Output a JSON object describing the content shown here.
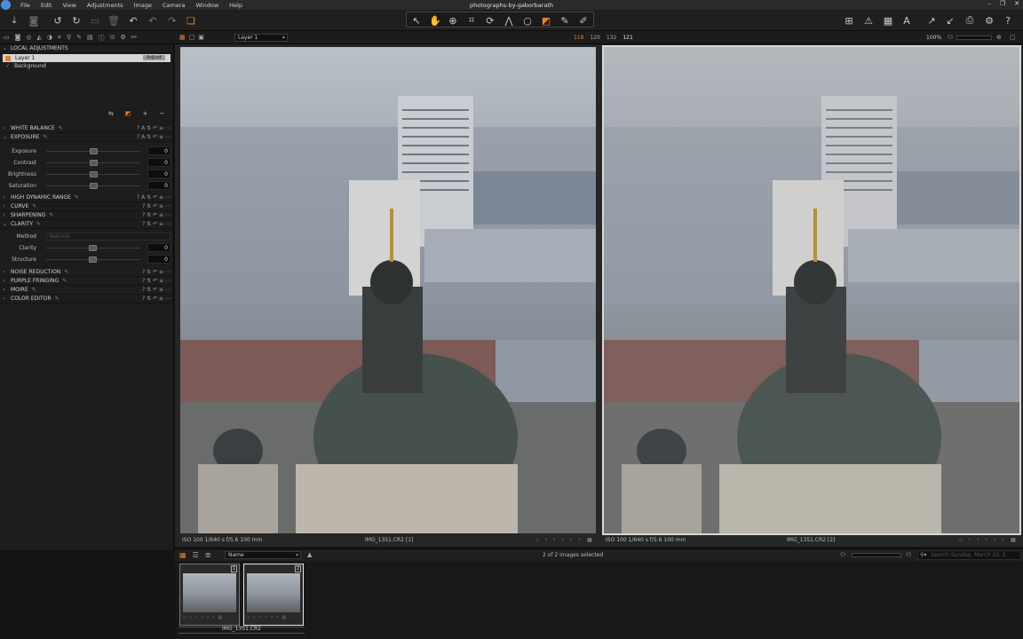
{
  "menubar": {
    "items": [
      "File",
      "Edit",
      "View",
      "Adjustments",
      "Image",
      "Camera",
      "Window",
      "Help"
    ],
    "title": "photographs-by-gaborbarath"
  },
  "subbar": {
    "layer_select": "Layer 1",
    "exposure_counts": [
      "118",
      "120",
      "132",
      "121"
    ],
    "zoom": "100%"
  },
  "local_adjustments": {
    "header": "LOCAL ADJUSTMENTS",
    "layers": [
      {
        "name": "Layer 1",
        "badge": "Adjust"
      },
      {
        "name": "Background"
      }
    ]
  },
  "tools": [
    {
      "label": "WHITE BALANCE"
    },
    {
      "label": "EXPOSURE",
      "expanded": true,
      "sliders": [
        {
          "label": "Exposure",
          "value": "0",
          "pos": 0.5
        },
        {
          "label": "Contrast",
          "value": "0",
          "pos": 0.5
        },
        {
          "label": "Brightness",
          "value": "0",
          "pos": 0.5
        },
        {
          "label": "Saturation",
          "value": "0",
          "pos": 0.5
        }
      ]
    },
    {
      "label": "HIGH DYNAMIC RANGE"
    },
    {
      "label": "CURVE"
    },
    {
      "label": "SHARPENING"
    },
    {
      "label": "CLARITY",
      "expanded": true,
      "method_label": "Method",
      "method_value": "Natural",
      "sliders": [
        {
          "label": "Clarity",
          "value": "0",
          "pos": 0.5
        },
        {
          "label": "Structure",
          "value": "0",
          "pos": 0.5
        }
      ]
    },
    {
      "label": "NOISE REDUCTION"
    },
    {
      "label": "PURPLE FRINGING"
    },
    {
      "label": "MOIRE"
    },
    {
      "label": "COLOR EDITOR"
    }
  ],
  "viewer": {
    "left": {
      "meta": "ISO 100  1/640 s  f/5.6  100 mm",
      "name": "IMG_1351.CR2 [1]"
    },
    "right": {
      "meta": "ISO 100  1/640 s  f/5.6  100 mm",
      "name": "IMG_1351.CR2 [2]"
    }
  },
  "filmbar": {
    "sort": "Name",
    "status": "2 of 2 images selected",
    "search_placeholder": "Search Sunday, March 20, 2"
  },
  "film": {
    "badges": [
      "1",
      "2"
    ],
    "label": "IMG_1351.CR2"
  },
  "colors": {
    "accent": "#e7822a",
    "selection": "#d8d8d8"
  }
}
